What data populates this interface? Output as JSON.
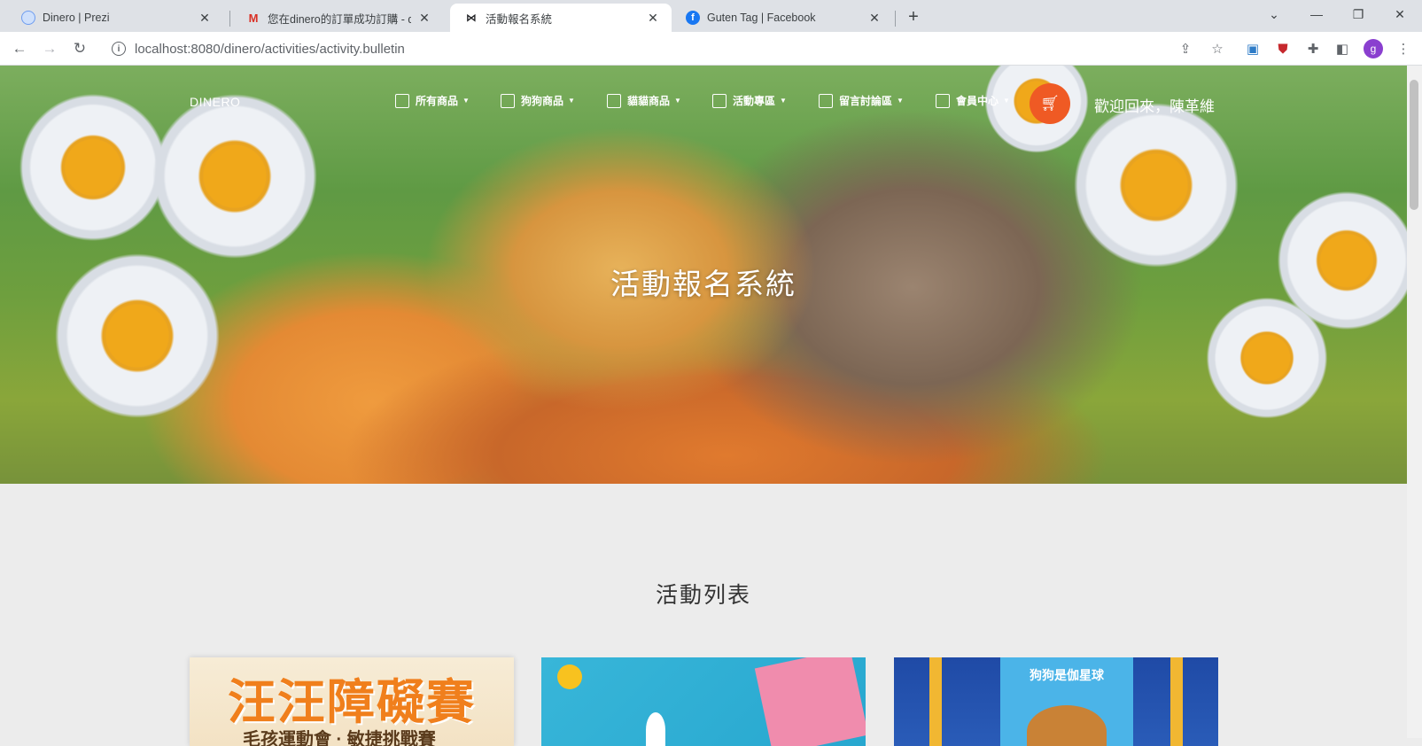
{
  "browser": {
    "tabs": [
      {
        "title": "Dinero | Prezi",
        "icon": "prezi-icon",
        "active": false
      },
      {
        "title": "您在dinero的訂單成功訂購 - do",
        "icon": "gmail-icon",
        "active": false
      },
      {
        "title": "活動報名系統",
        "icon": "bowtie-icon",
        "active": true
      },
      {
        "title": "Guten Tag | Facebook",
        "icon": "facebook-icon",
        "active": false
      }
    ],
    "url": "localhost:8080/dinero/activities/activity.bulletin",
    "profile_initial": "g"
  },
  "site": {
    "brand": "DINERO",
    "nav": [
      {
        "label": "所有商品",
        "icon": "box-icon"
      },
      {
        "label": "狗狗商品",
        "icon": "box-icon"
      },
      {
        "label": "貓貓商品",
        "icon": "document-icon"
      },
      {
        "label": "活動專區",
        "icon": "image-icon"
      },
      {
        "label": "留言討論區",
        "icon": "box-icon"
      },
      {
        "label": "會員中心",
        "icon": "box-icon"
      }
    ],
    "welcome": "歡迎回來，陳革維",
    "hero_title": "活動報名系統",
    "section_title": "活動列表",
    "cards": [
      {
        "headline": "汪汪障礙賽",
        "subline": "毛孩運動會 · 敏捷挑戰賽"
      },
      {
        "headline": ""
      },
      {
        "headline": "狗狗是伽星球"
      }
    ]
  },
  "colors": {
    "accent": "#ef5a24",
    "tabbar": "#dee1e6",
    "page_bg": "#ececec"
  }
}
